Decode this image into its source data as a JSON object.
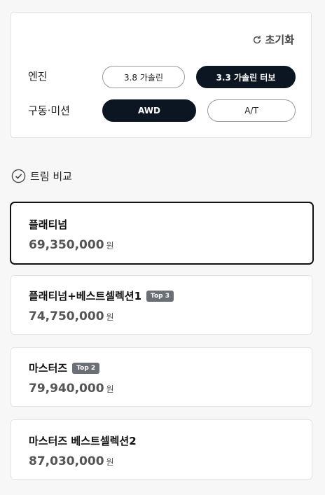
{
  "filters": {
    "reset_label": "초기화",
    "engine": {
      "label": "엔진",
      "options": [
        {
          "label": "3.8 가솔린",
          "selected": false
        },
        {
          "label": "3.3 가솔린 터보",
          "selected": true
        }
      ]
    },
    "drivetrain": {
      "label": "구동·미션",
      "options": [
        {
          "label": "AWD",
          "selected": true
        },
        {
          "label": "A/T",
          "selected": false
        }
      ]
    }
  },
  "trim_compare": {
    "label": "트림 비교"
  },
  "trims": [
    {
      "name": "플래티넘",
      "badge": "",
      "price": "69,350,000",
      "unit": "원",
      "selected": true
    },
    {
      "name": "플래티넘+베스트셀렉션1",
      "badge": "Top 3",
      "price": "74,750,000",
      "unit": "원",
      "selected": false
    },
    {
      "name": "마스터즈",
      "badge": "Top 2",
      "price": "79,940,000",
      "unit": "원",
      "selected": false
    },
    {
      "name": "마스터즈 베스트셀렉션2",
      "badge": "",
      "price": "87,030,000",
      "unit": "원",
      "selected": false
    }
  ],
  "colors": {
    "selected_fill": "#0b1622",
    "badge_bg": "#6b6f76"
  }
}
